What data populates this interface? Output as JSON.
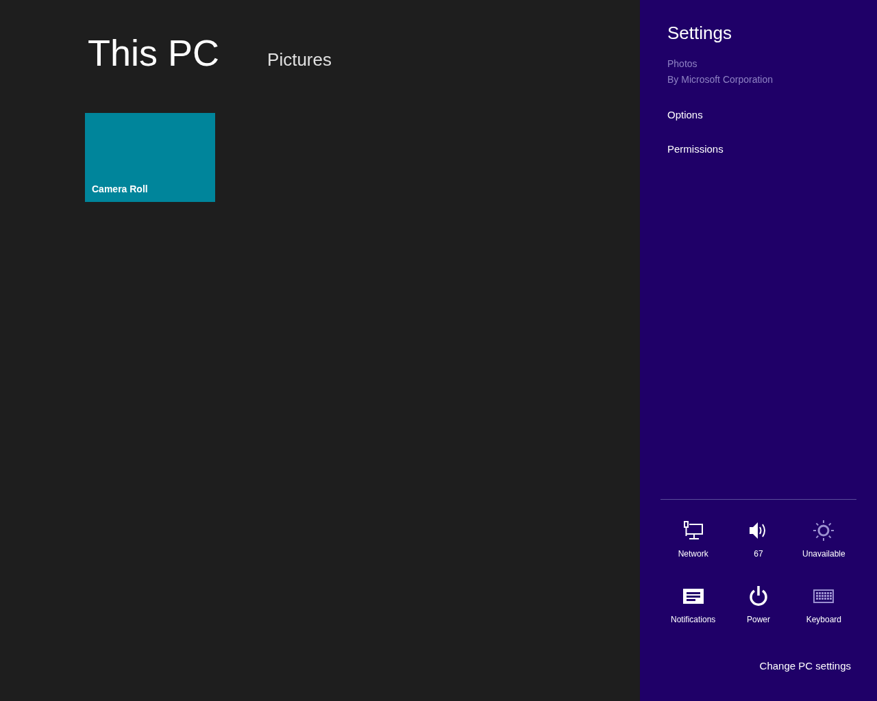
{
  "app": {
    "title": "This PC",
    "breadcrumb": "Pictures",
    "folders": [
      {
        "name": "Camera Roll"
      }
    ]
  },
  "settings_pane": {
    "title": "Settings",
    "app_name": "Photos",
    "publisher": "By Microsoft Corporation",
    "links": [
      "Options",
      "Permissions"
    ],
    "quick_settings": [
      {
        "kind": "network",
        "label": "Network",
        "disabled": false
      },
      {
        "kind": "volume",
        "label": "67",
        "disabled": false
      },
      {
        "kind": "brightness",
        "label": "Unavailable",
        "disabled": true
      },
      {
        "kind": "notifications",
        "label": "Notifications",
        "disabled": false
      },
      {
        "kind": "power",
        "label": "Power",
        "disabled": false
      },
      {
        "kind": "keyboard",
        "label": "Keyboard",
        "disabled": true
      }
    ],
    "change_settings": "Change PC settings"
  }
}
